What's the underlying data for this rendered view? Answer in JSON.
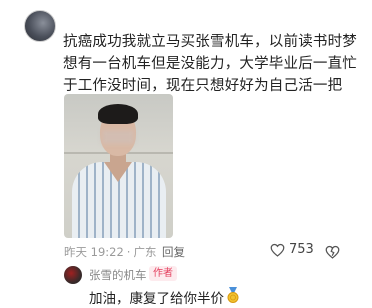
{
  "post": {
    "text": "抗癌成功我就立马买张雪机车，以前读书时梦想有一台机车但是没能力，大学毕业后一直忙于工作没时间，现在只想好好为自己活一把",
    "time": "昨天 19:22",
    "location": "广东",
    "reply_label": "回复",
    "like_count": "753"
  },
  "reply": {
    "name": "张雪的机车",
    "badge": "作者",
    "text": "加油，康复了给你半价"
  },
  "icons": [
    "avatar",
    "photo",
    "heart-icon",
    "dislike-icon",
    "medal-icon"
  ],
  "colors": {
    "badge": "#e4405f",
    "meta": "#9a9a9a"
  }
}
